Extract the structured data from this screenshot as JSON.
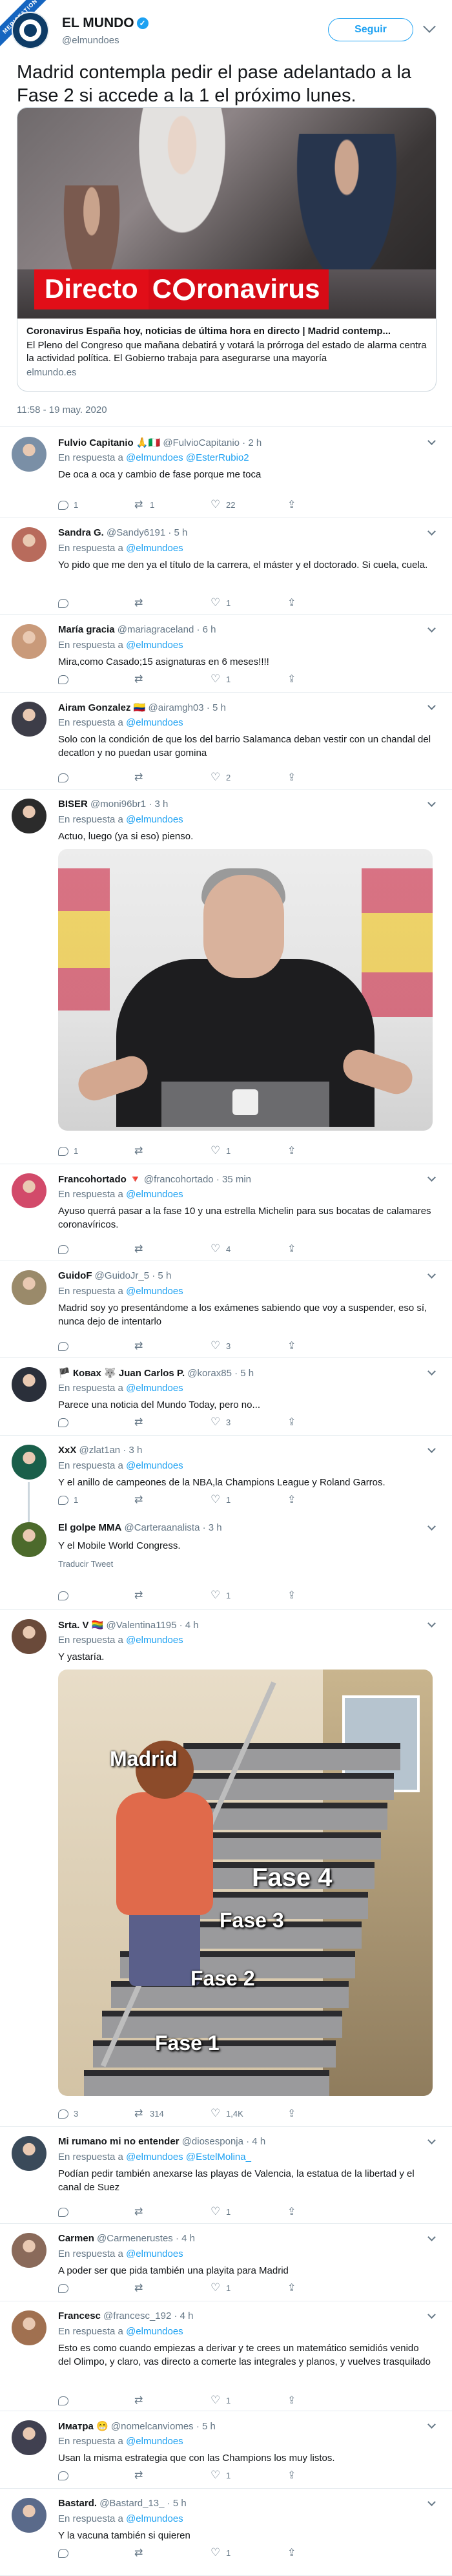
{
  "header": {
    "account_name": "EL MUNDO",
    "account_handle": "@elmundoes",
    "follow_label": "Seguir",
    "corner_badge": "MERISTATION"
  },
  "tweet": {
    "text": "Madrid contempla pedir el pase adelantado a la Fase 2 si accede a la 1 el próximo lunes.",
    "timestamp": "11:58 - 19 may. 2020"
  },
  "card": {
    "banner_left": "Directo",
    "banner_right_a": "C",
    "banner_right_b": "ronavirus",
    "title": "Coronavirus España hoy, noticias de última hora en directo | Madrid contemp...",
    "description": "El Pleno del Congreso que mañana debatirá y votará la prórroga del estado de alarma centra la actividad política. El Gobierno trabaja para asegurarse una mayoría",
    "domain": "elmundo.es"
  },
  "replies": [
    {
      "name": "Fulvio Capitanio 🙏🇮🇹",
      "handle": "@FulvioCapitanio · 2 h",
      "resp_prefix": "En respuesta a ",
      "resp_mention": "@elmundoes @EsterRubio2",
      "text": "De oca a oca y cambio de fase porque me toca",
      "replies": "1",
      "retweets": "1",
      "likes": "22"
    },
    {
      "name": "Sandra G.",
      "handle": "@Sandy6191 · 5 h",
      "resp_prefix": "En respuesta a ",
      "resp_mention": "@elmundoes",
      "text": "Yo pido que me den ya el título de la carrera, el máster y el doctorado. Si cuela, cuela.",
      "replies": "",
      "retweets": "",
      "likes": "1"
    },
    {
      "name": "María gracia",
      "handle": "@mariagraceland · 6 h",
      "resp_prefix": "En respuesta a ",
      "resp_mention": "@elmundoes",
      "text": "Mira,como Casado;15 asignaturas en 6 meses!!!!",
      "replies": "",
      "retweets": "",
      "likes": "1"
    },
    {
      "name": "Airam Gonzalez 🇨🇴",
      "handle": "@airamgh03 · 5 h",
      "resp_prefix": "En respuesta a ",
      "resp_mention": "@elmundoes",
      "text": "Solo con la condición de que los del barrio Salamanca deban vestir con un chandal del decatlon y no puedan usar gomina",
      "replies": "",
      "retweets": "",
      "likes": "2"
    },
    {
      "name": "BISER",
      "handle": "@moni96br1 · 3 h",
      "resp_prefix": "En respuesta a ",
      "resp_mention": "@elmundoes",
      "text": "Actuo, luego (ya si eso) pienso.",
      "replies": "1",
      "retweets": "",
      "likes": "1"
    },
    {
      "name": "Francohortado 🔻",
      "handle": "@francohortado · 35 min",
      "resp_prefix": "En respuesta a ",
      "resp_mention": "@elmundoes",
      "text": "Ayuso querrá pasar a la fase 10 y una estrella Michelin para sus bocatas de calamares coronavíricos.",
      "replies": "",
      "retweets": "",
      "likes": "4"
    },
    {
      "name": "GuidoF",
      "handle": "@GuidoJr_5 · 5 h",
      "resp_prefix": "En respuesta a ",
      "resp_mention": "@elmundoes",
      "text": "Madrid soy yo presentándome a los exámenes sabiendo que voy a suspender, eso sí, nunca dejo de intentarlo",
      "replies": "",
      "retweets": "",
      "likes": "3"
    },
    {
      "name": "🏴 Ковах 🐺 Juan Carlos P.",
      "handle": "@korax85 · 5 h",
      "resp_prefix": "En respuesta a ",
      "resp_mention": "@elmundoes",
      "text": "Parece una noticia del Mundo Today, pero no...",
      "replies": "",
      "retweets": "",
      "likes": "3"
    },
    {
      "name": "XxX",
      "handle": "@zlat1an · 3 h",
      "resp_prefix": "En respuesta a ",
      "resp_mention": "@elmundoes",
      "text": "Y el anillo de campeones de la NBA,la Champions League y Roland Garros.",
      "replies": "1",
      "retweets": "",
      "likes": "1"
    },
    {
      "name": "El golpe MMA",
      "handle": "@Carteraanalista · 3 h",
      "resp_prefix": "",
      "resp_mention": "",
      "text": "Y el Mobile World Congress.",
      "translate": "Traducir Tweet",
      "replies": "",
      "retweets": "",
      "likes": "1"
    },
    {
      "name": "Srta. V 🏳️‍🌈",
      "handle": "@Valentina1195 · 4 h",
      "resp_prefix": "En respuesta a ",
      "resp_mention": "@elmundoes",
      "text": "Y yastaría.",
      "replies": "3",
      "retweets": "314",
      "likes": "1,4K"
    },
    {
      "name": "Mi rumano mi no entender",
      "handle": "@diosesponja · 4 h",
      "resp_prefix": "En respuesta a ",
      "resp_mention": "@elmundoes @EstelMolina_",
      "text": "Podían pedir también anexarse las playas de Valencia, la estatua de la libertad y el canal de Suez",
      "replies": "",
      "retweets": "",
      "likes": "1"
    },
    {
      "name": "Carmen",
      "handle": "@Carmenerustes · 4 h",
      "resp_prefix": "En respuesta a ",
      "resp_mention": "@elmundoes",
      "text": "A poder ser que pida también una playita para Madrid",
      "replies": "",
      "retweets": "",
      "likes": "1"
    },
    {
      "name": "Francesc",
      "handle": "@francesc_192 · 4 h",
      "resp_prefix": "En respuesta a ",
      "resp_mention": "@elmundoes",
      "text": "Esto es como cuando empiezas a derivar y te crees un matemático semidiós venido del Olimpo, y claro, vas directo a comerte las integrales y planos, y vuelves trasquilado",
      "replies": "",
      "retweets": "",
      "likes": "1"
    },
    {
      "name": "Иматра 😁",
      "handle": "@nomelcanviomes · 5 h",
      "resp_prefix": "En respuesta a ",
      "resp_mention": "@elmundoes",
      "text": "Usan la misma estrategia que con las Champions los muy listos.",
      "replies": "",
      "retweets": "",
      "likes": "1"
    },
    {
      "name": "Bastard.",
      "handle": "@Bastard_13_ · 5 h",
      "resp_prefix": "En respuesta a ",
      "resp_mention": "@elmundoes",
      "text": "Y la vacuna también si quieren",
      "replies": "",
      "retweets": "",
      "likes": "1"
    }
  ],
  "meme": {
    "label_madrid": "Madrid",
    "label_fase4": "Fase 4",
    "label_fase3": "Fase 3",
    "label_fase2": "Fase 2",
    "label_fase1": "Fase 1"
  },
  "icons": {
    "verified": "verified-badge-icon",
    "reply": "reply-icon",
    "retweet": "retweet-icon",
    "like": "like-heart-icon",
    "share": "share-icon",
    "caret": "chevron-down-icon"
  },
  "colors": {
    "accent": "#1da1f2",
    "secondary_text": "#657786",
    "banner_red": "#e10e18"
  }
}
